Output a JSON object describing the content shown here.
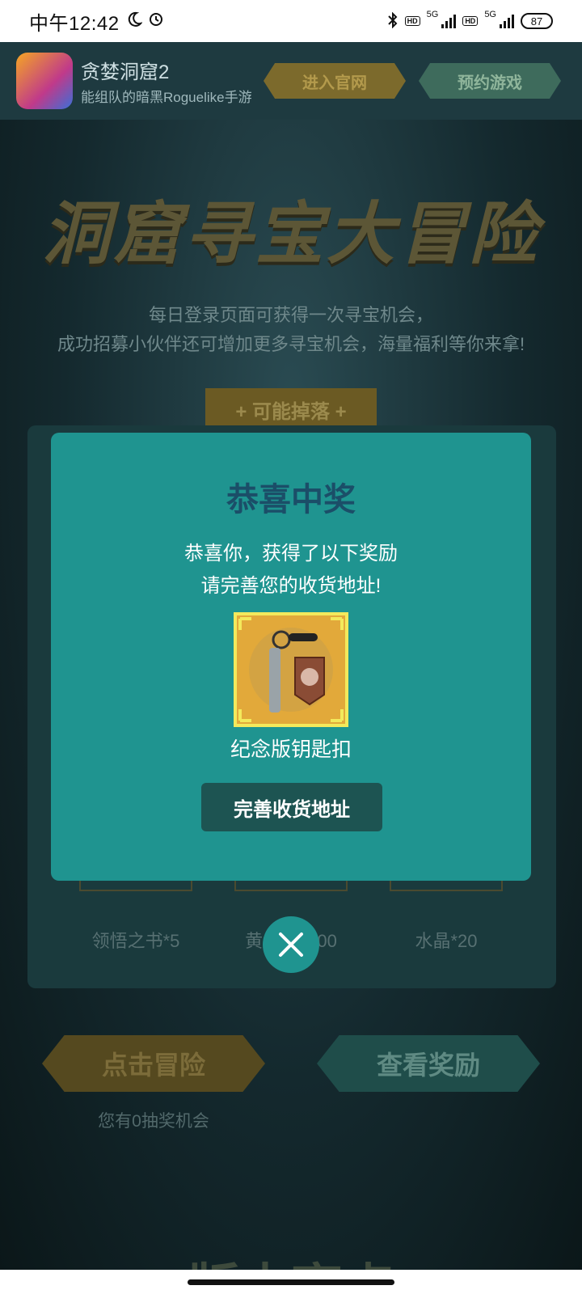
{
  "status_bar": {
    "time": "中午12:42",
    "battery": "87",
    "network": "5G"
  },
  "app_header": {
    "name": "贪婪洞窟2",
    "subtitle": "能组队的暗黑Roguelike手游",
    "official_site_label": "进入官网",
    "reserve_label": "预约游戏"
  },
  "event": {
    "title": "洞窟寻宝大冒险",
    "intro_line1": "每日登录页面可获得一次寻宝机会，",
    "intro_line2": "成功招募小伙伴还可增加更多寻宝机会，海量福利等你来拿!",
    "drops_tag": "+ 可能掉落 +",
    "drops": [
      {
        "label": "领悟之书*5"
      },
      {
        "label": "黄金*10000"
      },
      {
        "label": "水晶*20"
      }
    ],
    "adventure_label": "点击冒险",
    "rewards_label": "查看奖励",
    "chances_text": "您有0抽奖机会",
    "bottom_title": "版本亮点"
  },
  "modal": {
    "title": "恭喜中奖",
    "message_line1": "恭喜你，获得了以下奖励",
    "message_line2": "请完善您的收货地址!",
    "prize_name": "纪念版钥匙扣",
    "confirm_label": "完善收货地址"
  },
  "colors": {
    "modal_bg": "#1f9490",
    "modal_title": "#1b4e68",
    "button_bg": "#1d5452",
    "prize_frame": "#f3e95c"
  }
}
